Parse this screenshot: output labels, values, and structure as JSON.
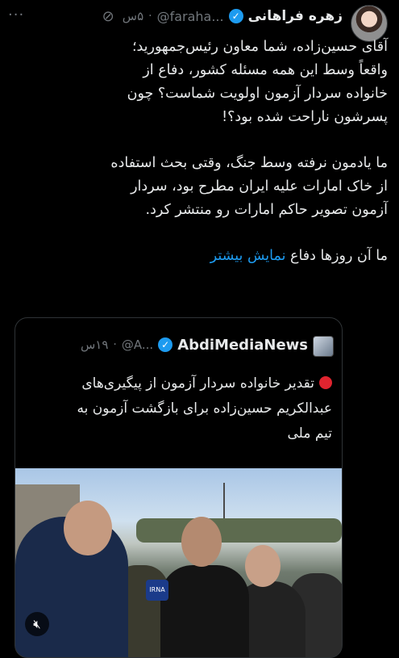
{
  "tweet": {
    "author_name": "زهره فراهانی",
    "handle": "@faraha...",
    "time": "۵س",
    "separator": "·",
    "body_lines": [
      "آقای حسین‌زاده، شما معاون رئیس‌جمهورید؛",
      "واقعاً وسط این همه مسئله کشور، دفاع از",
      "خانواده سردار آزمون اولویت شماست؟ چون",
      "پسرشون ناراحت شده بود؟!"
    ],
    "body_lines_2": [
      "ما یادمون نرفته وسط جنگ، وقتی بحث استفاده",
      "از خاک امارات علیه ایران مطرح بود، سردار",
      "آزمون تصویر حاکم امارات رو منتشر کرد."
    ],
    "body_line_3": "ما آن روزها دفاع",
    "show_more": "نمایش بیشتر"
  },
  "quote": {
    "author_name": "AbdiMediaNews",
    "handle": "@A...",
    "time": "۱۹س",
    "separator": "·",
    "text_lines": [
      "تقدیر خانواده سردار آزمون از پیگیری‌های",
      "عبدالکریم حسین‌زاده برای بازگشت آزمون به",
      "تیم ملی"
    ],
    "media_badge": "IRNA"
  },
  "icons": {
    "verified": "verified-badge-icon",
    "grok": "grok-icon",
    "more": "more-icon",
    "mute": "mute-icon"
  },
  "colors": {
    "background": "#000000",
    "text": "#e7e9ea",
    "secondary": "#71767b",
    "link": "#1d9bf0",
    "verified": "#1d9bf0",
    "red_dot": "#e0242f"
  }
}
